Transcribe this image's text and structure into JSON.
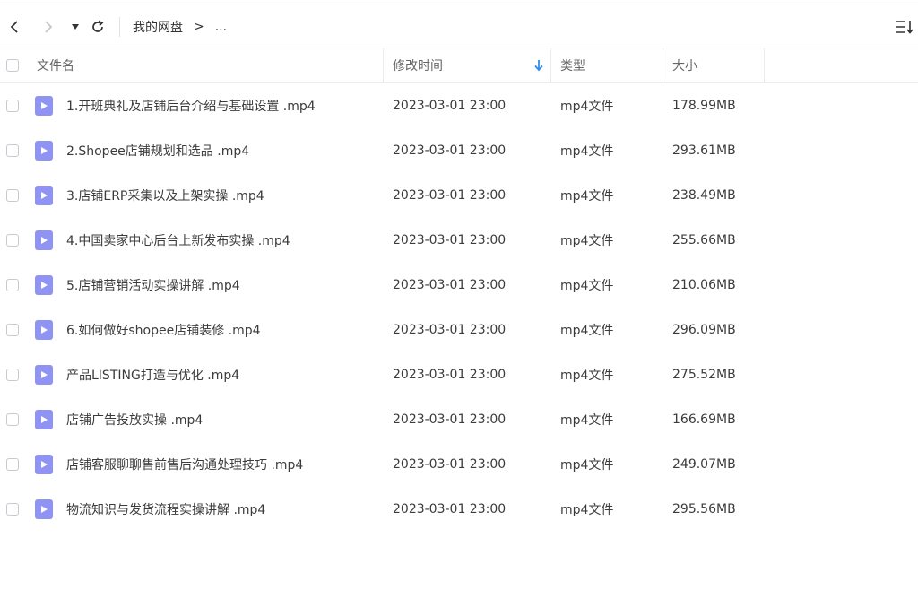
{
  "breadcrumb": {
    "root": "我的网盘",
    "separator": ">",
    "more": "..."
  },
  "columns": {
    "name": "文件名",
    "modified": "修改时间",
    "type": "类型",
    "size": "大小"
  },
  "files": [
    {
      "name": "1.开班典礼及店铺后台介绍与基础设置 .mp4",
      "modified": "2023-03-01 23:00",
      "type": "mp4文件",
      "size": "178.99MB"
    },
    {
      "name": "2.Shopee店铺规划和选品 .mp4",
      "modified": "2023-03-01 23:00",
      "type": "mp4文件",
      "size": "293.61MB"
    },
    {
      "name": "3.店铺ERP采集以及上架实操 .mp4",
      "modified": "2023-03-01 23:00",
      "type": "mp4文件",
      "size": "238.49MB"
    },
    {
      "name": "4.中国卖家中心后台上新发布实操 .mp4",
      "modified": "2023-03-01 23:00",
      "type": "mp4文件",
      "size": "255.66MB"
    },
    {
      "name": "5.店铺营销活动实操讲解 .mp4",
      "modified": "2023-03-01 23:00",
      "type": "mp4文件",
      "size": "210.06MB"
    },
    {
      "name": "6.如何做好shopee店铺装修 .mp4",
      "modified": "2023-03-01 23:00",
      "type": "mp4文件",
      "size": "296.09MB"
    },
    {
      "name": "产品LISTING打造与优化 .mp4",
      "modified": "2023-03-01 23:00",
      "type": "mp4文件",
      "size": "275.52MB"
    },
    {
      "name": "店铺广告投放实操 .mp4",
      "modified": "2023-03-01 23:00",
      "type": "mp4文件",
      "size": "166.69MB"
    },
    {
      "name": "店铺客服聊聊售前售后沟通处理技巧 .mp4",
      "modified": "2023-03-01 23:00",
      "type": "mp4文件",
      "size": "249.07MB"
    },
    {
      "name": "物流知识与发货流程实操讲解 .mp4",
      "modified": "2023-03-01 23:00",
      "type": "mp4文件",
      "size": "295.56MB"
    }
  ],
  "colors": {
    "file_icon": "#8f93f3",
    "sort_arrow": "#2f8cf5"
  }
}
